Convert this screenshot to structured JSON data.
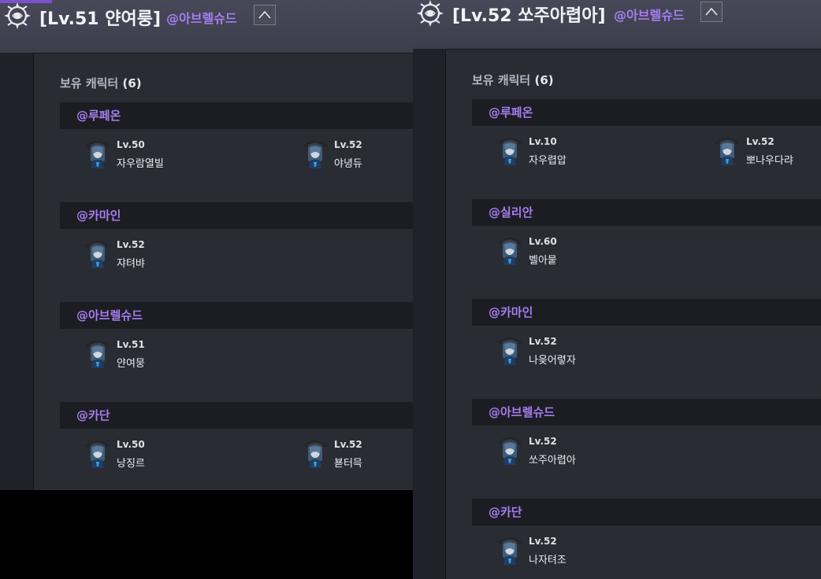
{
  "left_panel": {
    "title": "[Lv.51 얀여룽]",
    "guild_handle": "@아브렐슈드",
    "section_label": "보유 캐릭터",
    "section_count": "(6)",
    "servers": [
      {
        "name": "@루페온",
        "characters": [
          {
            "level": "Lv.50",
            "name": "자우람열빌"
          },
          {
            "level": "Lv.52",
            "name": "야녕듀"
          }
        ]
      },
      {
        "name": "@카마인",
        "characters": [
          {
            "level": "Lv.52",
            "name": "쟈텨뱌"
          }
        ]
      },
      {
        "name": "@아브렐슈드",
        "characters": [
          {
            "level": "Lv.51",
            "name": "얀여뭉"
          }
        ]
      },
      {
        "name": "@카단",
        "characters": [
          {
            "level": "Lv.50",
            "name": "낭징르"
          },
          {
            "level": "Lv.52",
            "name": "뵫터믁"
          }
        ]
      }
    ]
  },
  "right_panel": {
    "title": "[Lv.52 쏘주아렵아]",
    "guild_handle": "@아브렐슈드",
    "section_label": "보유 캐릭터",
    "section_count": "(6)",
    "servers": [
      {
        "name": "@루페온",
        "characters": [
          {
            "level": "Lv.10",
            "name": "자우렵압"
          },
          {
            "level": "Lv.52",
            "name": "뽀나우다랴"
          }
        ]
      },
      {
        "name": "@실리안",
        "characters": [
          {
            "level": "Lv.60",
            "name": "벨아뭍"
          }
        ]
      },
      {
        "name": "@카마인",
        "characters": [
          {
            "level": "Lv.52",
            "name": "나읒어렿자"
          }
        ]
      },
      {
        "name": "@아브렐슈드",
        "characters": [
          {
            "level": "Lv.52",
            "name": "쏘주아렵아"
          }
        ]
      },
      {
        "name": "@카단",
        "characters": [
          {
            "level": "Lv.52",
            "name": "나자텨조"
          }
        ]
      }
    ]
  },
  "icons": {
    "logo": "guild-emblem-icon",
    "collapse": "chevron-up-icon",
    "avatar": "character-portrait-icon"
  },
  "colors": {
    "accent_purple": "#a67df0",
    "header_bg": "#43455a",
    "content_bg": "#2a2c34",
    "server_header_bg": "#1c1d23"
  }
}
